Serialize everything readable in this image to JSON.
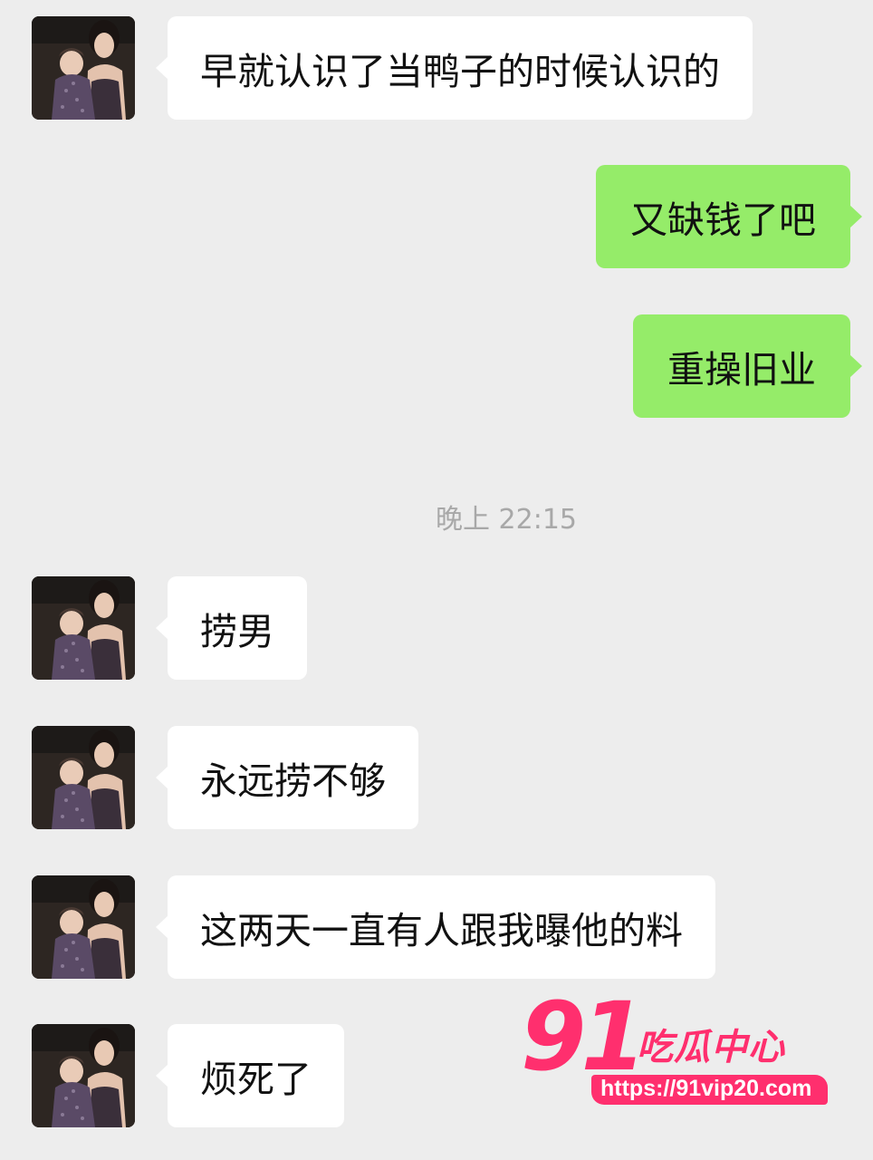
{
  "messages": [
    {
      "side": "in",
      "text": "早就认识了当鸭子的时候认识的"
    },
    {
      "side": "out",
      "text": "又缺钱了吧"
    },
    {
      "side": "out",
      "text": "重操旧业"
    },
    {
      "side": "in",
      "text": "捞男"
    },
    {
      "side": "in",
      "text": "永远捞不够"
    },
    {
      "side": "in",
      "text": "这两天一直有人跟我曝他的料"
    },
    {
      "side": "in",
      "text": "烦死了"
    }
  ],
  "timestamp": "晚上 22:15",
  "watermark": {
    "number": "91",
    "brand": "吃瓜中心",
    "url": "https://91vip20.com"
  },
  "colors": {
    "background": "#ededed",
    "incoming_bubble": "#ffffff",
    "outgoing_bubble": "#95ec69",
    "timestamp_text": "#a8a8a8",
    "watermark": "#ff2f6e"
  },
  "icons": {
    "contact_avatar": "avatar-photo"
  }
}
